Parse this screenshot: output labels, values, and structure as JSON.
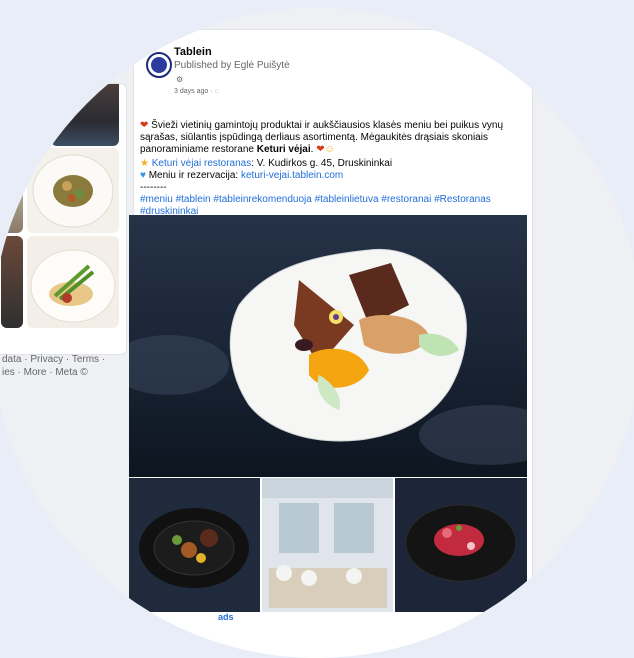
{
  "post": {
    "page_name": "Tablein",
    "published_by": "Published by Eglė Puišytė",
    "time": "3 days ago · ",
    "line1": "Švieži vietinių gamintojų produktai ir aukščiausios klasės meniu bei puikus vynų sąrašas, siūlantis įspūdingą derliaus asortimentą.",
    "line2_pre": "Mėgaukitės drąsiais skoniais panoraminiame restorane ",
    "line2_bold": "Keturi vėjai",
    "restaurant_link": "Keturi vėjai restoranas",
    "restaurant_address": ": V. Kudirkos g. 45, Druskininkai",
    "menu_label": "Meniu ir rezervacija: ",
    "menu_link": "keturi-vejai.tablein.com",
    "separator": "--------",
    "hashtags": "#meniu #tablein #tableinrekomenduoja #tableinlietuva #restoranai #Restoranas #druskininkai"
  },
  "sidebar": {
    "footer_line1": "data · Privacy · Terms ·",
    "footer_line2": "ies · More · Meta ©"
  },
  "ads_text": "ads",
  "colors": {
    "link": "#216fdb",
    "plate_bg": "#1e2a3e"
  }
}
